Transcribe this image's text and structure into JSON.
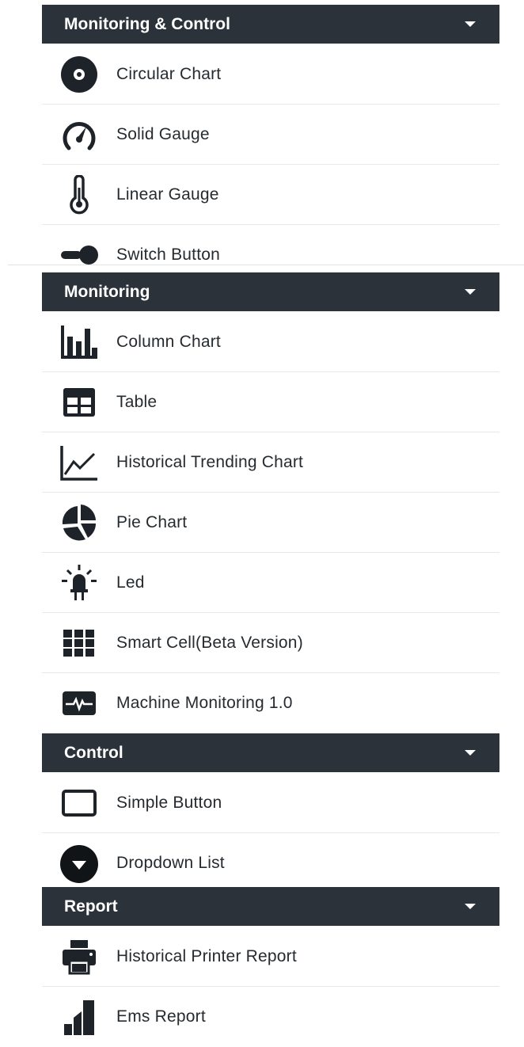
{
  "sections": [
    {
      "title": "Monitoring & Control",
      "items": [
        {
          "label": "Circular Chart",
          "icon": "circular-chart-icon"
        },
        {
          "label": "Solid Gauge",
          "icon": "solid-gauge-icon"
        },
        {
          "label": "Linear Gauge",
          "icon": "thermometer-icon"
        },
        {
          "label": "Switch Button",
          "icon": "switch-toggle-icon"
        }
      ]
    },
    {
      "title": "Monitoring",
      "items": [
        {
          "label": "Column Chart",
          "icon": "column-chart-icon"
        },
        {
          "label": "Table",
          "icon": "table-icon"
        },
        {
          "label": "Historical Trending Chart",
          "icon": "line-chart-icon"
        },
        {
          "label": "Pie Chart",
          "icon": "pie-chart-icon"
        },
        {
          "label": "Led",
          "icon": "led-icon"
        },
        {
          "label": "Smart Cell(Beta Version)",
          "icon": "grid-cells-icon"
        },
        {
          "label": "Machine Monitoring 1.0",
          "icon": "heartbeat-monitor-icon"
        }
      ]
    },
    {
      "title": "Control",
      "items": [
        {
          "label": "Simple Button",
          "icon": "button-outline-icon"
        },
        {
          "label": "Dropdown List",
          "icon": "dropdown-circle-icon"
        }
      ]
    },
    {
      "title": "Report",
      "items": [
        {
          "label": "Historical Printer Report",
          "icon": "printer-icon"
        },
        {
          "label": "Ems Report",
          "icon": "ems-report-icon"
        }
      ]
    }
  ],
  "colors": {
    "header_bg": "#2b323a",
    "header_text": "#ffffff",
    "icon": "#1d2329"
  }
}
